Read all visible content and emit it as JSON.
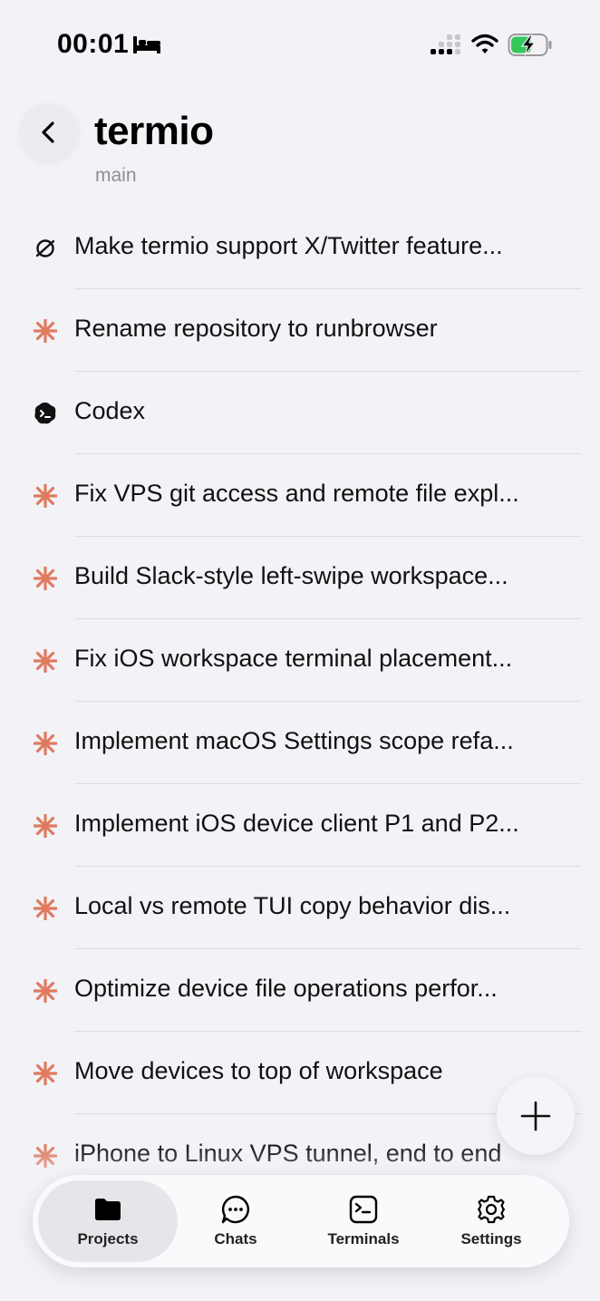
{
  "status_bar": {
    "time": "00:01"
  },
  "header": {
    "title": "termio",
    "branch": "main"
  },
  "accent_color": "#e07a5f",
  "sessions": [
    {
      "icon": "openai-icon",
      "label": "Make termio support X/Twitter feature..."
    },
    {
      "icon": "claude-sparkle-icon",
      "label": "Rename repository to runbrowser"
    },
    {
      "icon": "codex-icon",
      "label": "Codex"
    },
    {
      "icon": "claude-sparkle-icon",
      "label": "Fix VPS git access and remote file expl..."
    },
    {
      "icon": "claude-sparkle-icon",
      "label": "Build Slack-style left-swipe workspace..."
    },
    {
      "icon": "claude-sparkle-icon",
      "label": "Fix iOS workspace terminal placement..."
    },
    {
      "icon": "claude-sparkle-icon",
      "label": "Implement macOS Settings scope refa..."
    },
    {
      "icon": "claude-sparkle-icon",
      "label": "Implement iOS device client P1 and P2..."
    },
    {
      "icon": "claude-sparkle-icon",
      "label": "Local vs remote TUI copy behavior dis..."
    },
    {
      "icon": "claude-sparkle-icon",
      "label": "Optimize device file operations perfor..."
    },
    {
      "icon": "claude-sparkle-icon",
      "label": "Move devices to top of workspace"
    },
    {
      "icon": "claude-sparkle-icon",
      "label": "iPhone to Linux VPS tunnel, end to end"
    }
  ],
  "tabs": [
    {
      "label": "Projects",
      "icon": "folder-icon",
      "active": true
    },
    {
      "label": "Chats",
      "icon": "chat-bubble-icon",
      "active": false
    },
    {
      "label": "Terminals",
      "icon": "terminal-icon",
      "active": false
    },
    {
      "label": "Settings",
      "icon": "gear-icon",
      "active": false
    }
  ]
}
